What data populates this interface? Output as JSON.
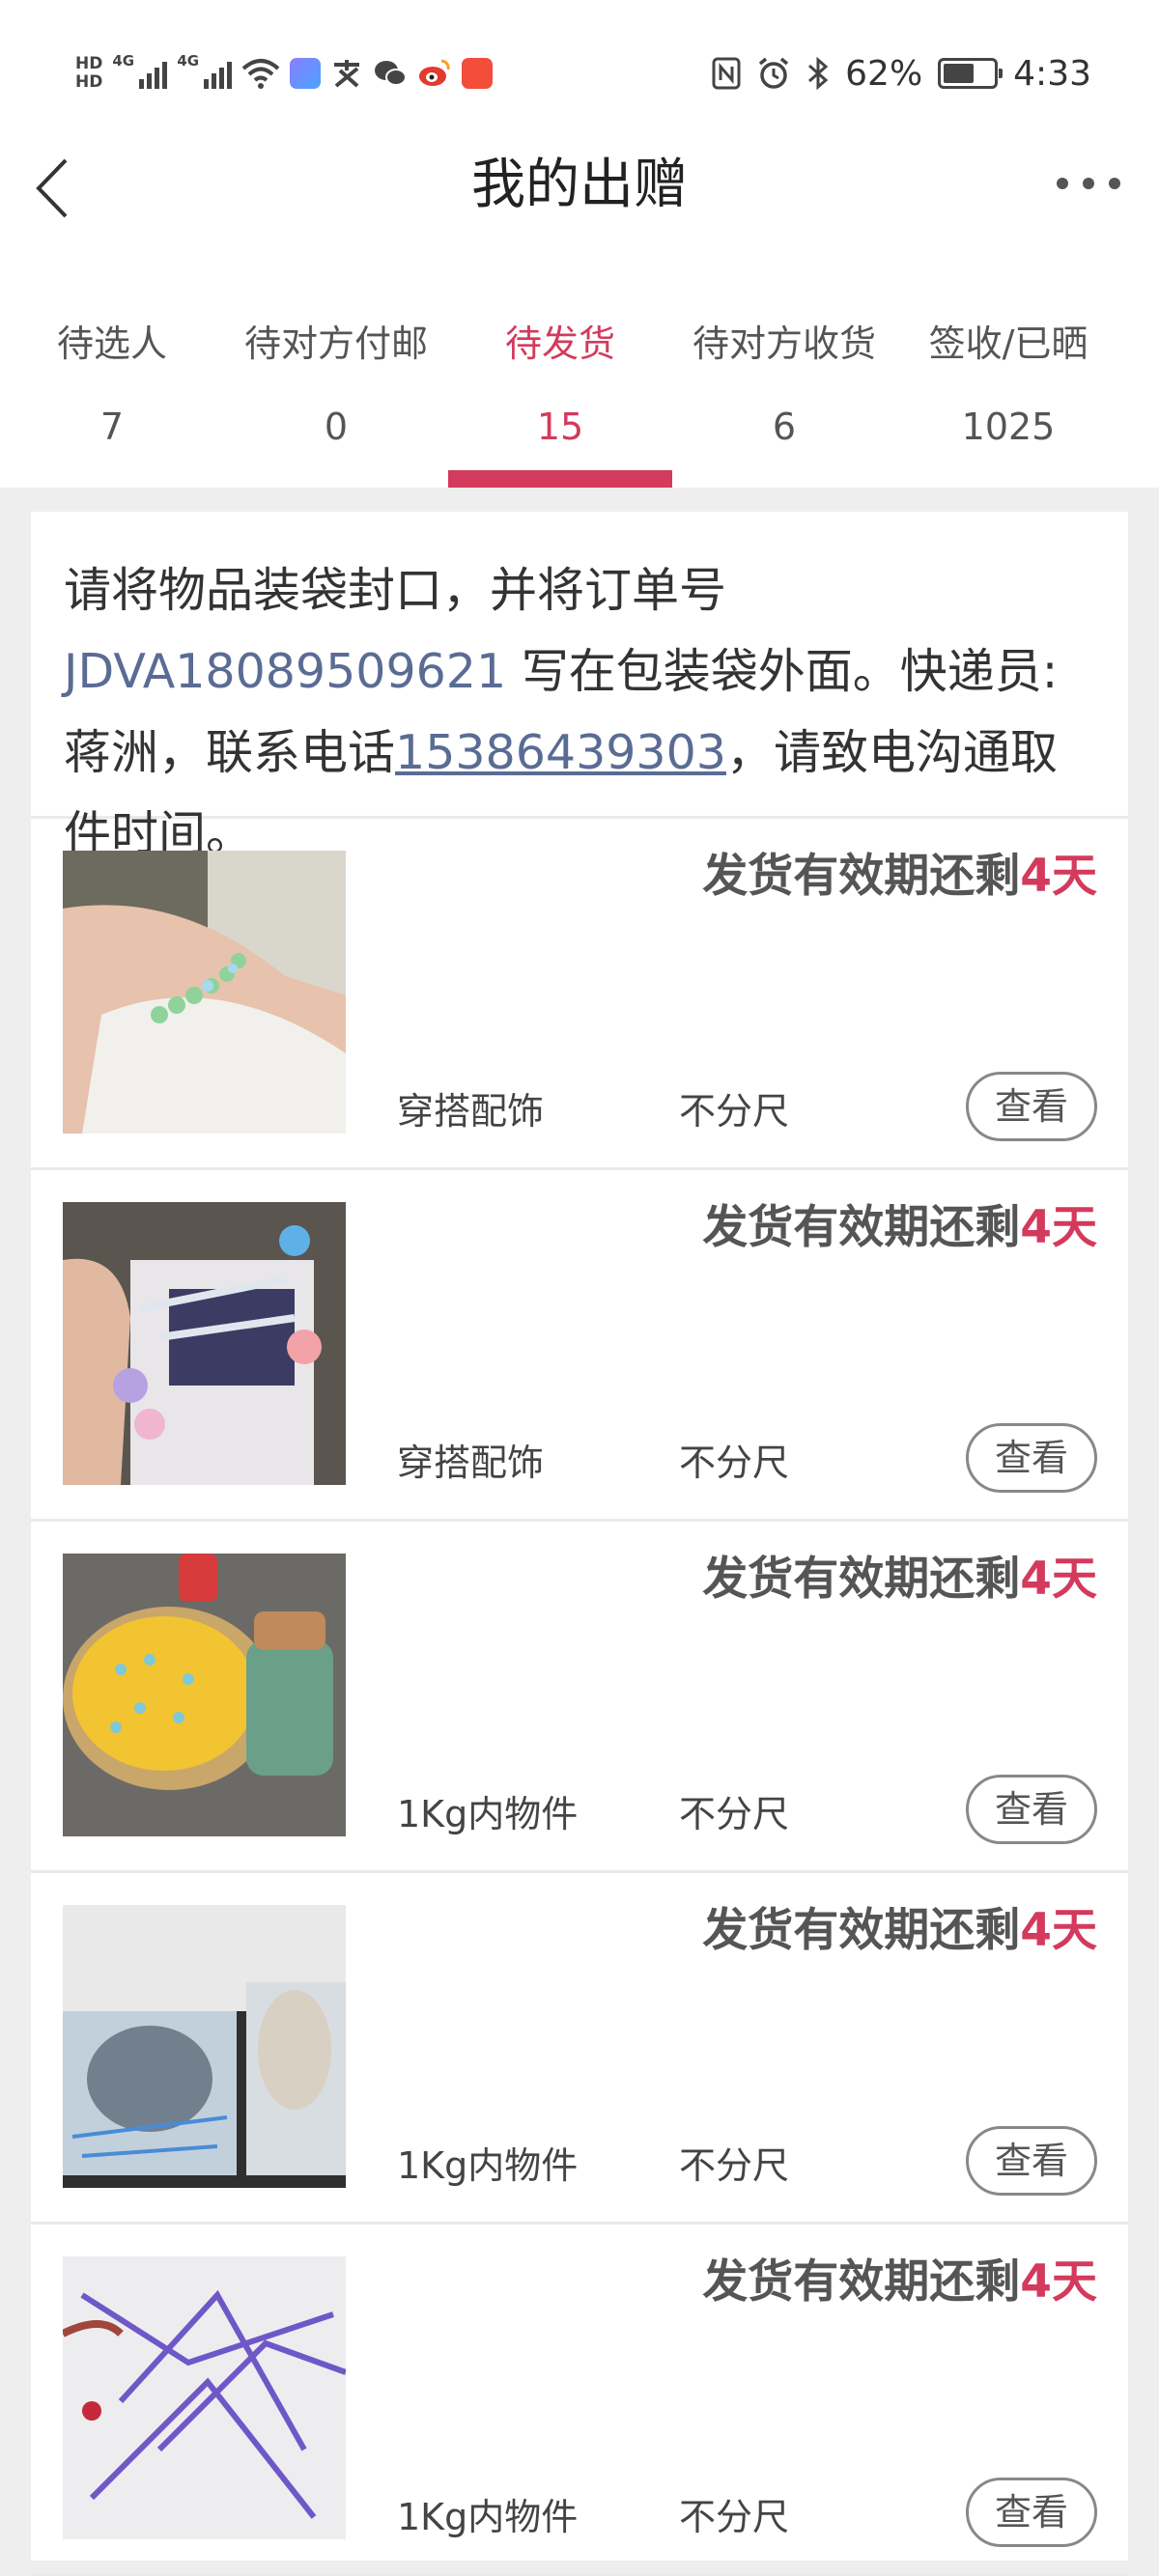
{
  "status_bar": {
    "hd1": "HD",
    "hd2": "HD",
    "net1": "4G",
    "net2": "4G",
    "battery_percent": "62%",
    "battery_level": 0.62,
    "time": "4:33",
    "icons": [
      "wifi-icon",
      "app-icon",
      "alipay-icon",
      "wechat-icon",
      "weibo-icon",
      "taobao-icon",
      "nfc-icon",
      "alarm-icon",
      "bluetooth-icon"
    ]
  },
  "header": {
    "title": "我的出赠"
  },
  "tabs": [
    {
      "label": "待选人",
      "count": "7"
    },
    {
      "label": "待对方付邮",
      "count": "0"
    },
    {
      "label": "待发货",
      "count": "15"
    },
    {
      "label": "待对方收货",
      "count": "6"
    },
    {
      "label": "签收/已晒",
      "count": "1025"
    }
  ],
  "active_tab": 2,
  "notice": {
    "prefix": "请将物品装袋封口，并将订单号 ",
    "order_no": "JDVA18089509621",
    "middle": " 写在包装袋外面。快递员:蒋洲，联系电话",
    "phone": "15386439303",
    "suffix": "，请致电沟通取件时间。"
  },
  "items": [
    {
      "deadline_prefix": "发货有效期还剩",
      "deadline_days": "4天",
      "category": "穿搭配饰",
      "size": "不分尺",
      "button": "查看"
    },
    {
      "deadline_prefix": "发货有效期还剩",
      "deadline_days": "4天",
      "category": "穿搭配饰",
      "size": "不分尺",
      "button": "查看"
    },
    {
      "deadline_prefix": "发货有效期还剩",
      "deadline_days": "4天",
      "category": "1Kg内物件",
      "size": "不分尺",
      "button": "查看"
    },
    {
      "deadline_prefix": "发货有效期还剩",
      "deadline_days": "4天",
      "category": "1Kg内物件",
      "size": "不分尺",
      "button": "查看"
    },
    {
      "deadline_prefix": "发货有效期还剩",
      "deadline_days": "4天",
      "category": "1Kg内物件",
      "size": "不分尺",
      "button": "查看"
    }
  ],
  "colors": {
    "accent": "#d33a5c",
    "link": "#5a6c94",
    "background": "#eeeeee"
  }
}
